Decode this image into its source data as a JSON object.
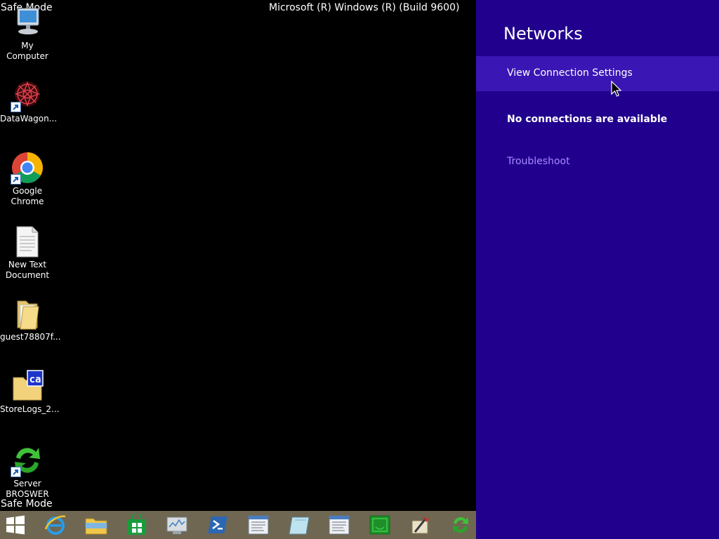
{
  "desktop": {
    "safe_mode_top": "Safe Mode",
    "safe_mode_bottom": "Safe Mode",
    "build_text": "Microsoft (R) Windows (R) (Build 9600)",
    "icons": [
      {
        "label": "My Computer",
        "icon": "computer-icon"
      },
      {
        "label": "DataWagon...",
        "icon": "datawagon-icon"
      },
      {
        "label": "Google Chrome",
        "icon": "chrome-icon"
      },
      {
        "label": "New Text Document",
        "icon": "text-document-icon"
      },
      {
        "label": "guest78807f...",
        "icon": "folder-icon"
      },
      {
        "label": "StoreLogs_2...",
        "icon": "ca-folder-icon"
      },
      {
        "label": "Server BROSWER",
        "icon": "green-arrows-icon"
      }
    ]
  },
  "taskbar": {
    "buttons": [
      "start-button",
      "internet-explorer",
      "file-explorer",
      "store",
      "performance-monitor",
      "powershell",
      "window-app-1",
      "notepad-app",
      "window-app-2",
      "green-app",
      "tools-app",
      "refresh-app"
    ]
  },
  "charm": {
    "title": "Networks",
    "view_connection_settings": "View Connection Settings",
    "no_connections": "No connections are available",
    "troubleshoot": "Troubleshoot"
  },
  "colors": {
    "charm_bg": "#21008e",
    "charm_highlight": "#3a16b5",
    "troubleshoot_link": "#a78bff",
    "taskbar_bg": "#6f6752"
  }
}
